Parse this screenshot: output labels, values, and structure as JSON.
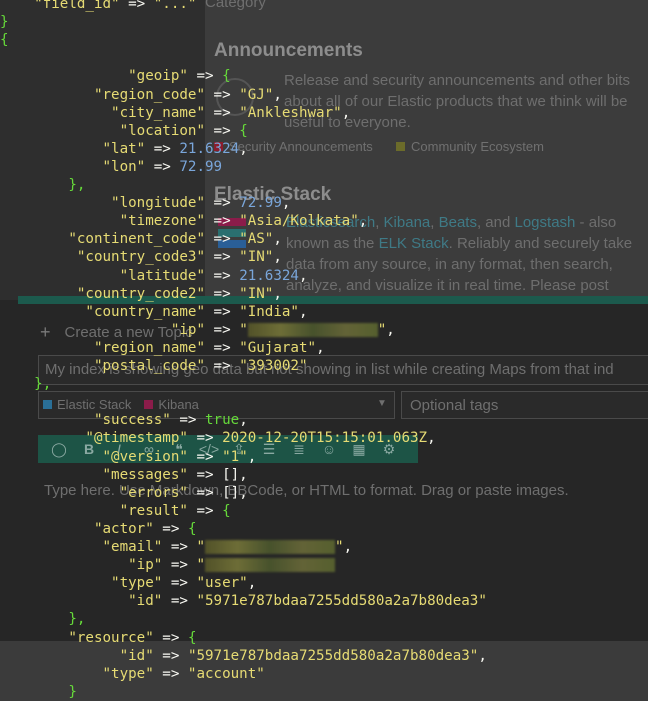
{
  "forum": {
    "category_label": "Category",
    "announcements": {
      "title": "Announcements",
      "description": "Release and security announcements and other bits about all of our Elastic products that we think will be useful to everyone.",
      "tags": [
        "Security Announcements",
        "Community Ecosystem"
      ]
    },
    "elastic_stack": {
      "title": "Elastic Stack",
      "desc_parts": [
        "Elasticsearch",
        ", ",
        "Kibana",
        ", ",
        "Beats",
        ", and ",
        "Logstash",
        " - also known as the ",
        "ELK Stack",
        ". Reliably and securely take data from any source, in any format, then search, analyze, and visualize it in real time. Please post"
      ]
    },
    "create_topic_label": "Create a new Topic",
    "topic_title_value": "My index is showing geo data but not showing in list while creating Maps from that ind",
    "category_select_value": "Elastic Stack",
    "category_tag": "Kibana",
    "optional_tags_placeholder": "Optional tags",
    "editor_placeholder": "Type here. Use Markdown, BBCode, or HTML to format. Drag or paste images."
  },
  "colors": {
    "security": "#8b1c2c",
    "community": "#6b6b2a",
    "elastic": "#2a6f97",
    "kibana": "#e64c7a",
    "toolbar": "#1d5446",
    "code_key": "#e6db74",
    "code_number": "#7aa6da",
    "code_brace": "#66d93a"
  },
  "code_lines": [
    {
      "indent": "    ",
      "parts": [
        [
          "k",
          "\"field_id\""
        ],
        [
          "o",
          " => "
        ],
        [
          "s",
          "\"...\""
        ]
      ]
    },
    {
      "indent": "",
      "parts": [
        [
          "p",
          "}"
        ]
      ]
    },
    {
      "indent": "",
      "parts": [
        [
          "p",
          "{"
        ]
      ]
    },
    {
      "indent": "",
      "parts": []
    },
    {
      "indent": "               ",
      "parts": [
        [
          "k",
          "\"geoip\""
        ],
        [
          "o",
          " => "
        ],
        [
          "p",
          "{"
        ]
      ]
    },
    {
      "indent": "           ",
      "parts": [
        [
          "k",
          "\"region_code\""
        ],
        [
          "o",
          " => "
        ],
        [
          "s",
          "\"GJ\""
        ],
        [
          "o",
          ","
        ]
      ]
    },
    {
      "indent": "             ",
      "parts": [
        [
          "k",
          "\"city_name\""
        ],
        [
          "o",
          " => "
        ],
        [
          "s",
          "\"Ankleshwar\""
        ],
        [
          "o",
          ","
        ]
      ]
    },
    {
      "indent": "              ",
      "parts": [
        [
          "k",
          "\"location\""
        ],
        [
          "o",
          " => "
        ],
        [
          "p",
          "{"
        ]
      ]
    },
    {
      "indent": "            ",
      "parts": [
        [
          "k",
          "\"lat\""
        ],
        [
          "o",
          " => "
        ],
        [
          "n",
          "21.6324"
        ],
        [
          "o",
          ","
        ]
      ]
    },
    {
      "indent": "            ",
      "parts": [
        [
          "k",
          "\"lon\""
        ],
        [
          "o",
          " => "
        ],
        [
          "n",
          "72.99"
        ]
      ]
    },
    {
      "indent": "        ",
      "parts": [
        [
          "p",
          "},"
        ]
      ]
    },
    {
      "indent": "             ",
      "parts": [
        [
          "k",
          "\"longitude\""
        ],
        [
          "o",
          " => "
        ],
        [
          "n",
          "72.99"
        ],
        [
          "o",
          ","
        ]
      ]
    },
    {
      "indent": "              ",
      "parts": [
        [
          "k",
          "\"timezone\""
        ],
        [
          "o",
          " => "
        ],
        [
          "s",
          "\"Asia/Kolkata\""
        ],
        [
          "o",
          ","
        ]
      ]
    },
    {
      "indent": "        ",
      "parts": [
        [
          "k",
          "\"continent_code\""
        ],
        [
          "o",
          " => "
        ],
        [
          "s",
          "\"AS\""
        ],
        [
          "o",
          ","
        ]
      ]
    },
    {
      "indent": "         ",
      "parts": [
        [
          "k",
          "\"country_code3\""
        ],
        [
          "o",
          " => "
        ],
        [
          "s",
          "\"IN\""
        ],
        [
          "o",
          ","
        ]
      ]
    },
    {
      "indent": "              ",
      "parts": [
        [
          "k",
          "\"latitude\""
        ],
        [
          "o",
          " => "
        ],
        [
          "n",
          "21.6324"
        ],
        [
          "o",
          ","
        ]
      ]
    },
    {
      "indent": "         ",
      "parts": [
        [
          "k",
          "\"country_code2\""
        ],
        [
          "o",
          " => "
        ],
        [
          "s",
          "\"IN\""
        ],
        [
          "o",
          ","
        ]
      ]
    },
    {
      "indent": "          ",
      "parts": [
        [
          "k",
          "\"country_name\""
        ],
        [
          "o",
          " => "
        ],
        [
          "s",
          "\"India\""
        ],
        [
          "o",
          ","
        ]
      ]
    },
    {
      "indent": "                    ",
      "parts": [
        [
          "k",
          "\"ip\""
        ],
        [
          "o",
          " => "
        ],
        [
          "s",
          "\""
        ],
        [
          "b",
          ""
        ],
        [
          "s",
          "\""
        ],
        [
          "o",
          ","
        ]
      ]
    },
    {
      "indent": "           ",
      "parts": [
        [
          "k",
          "\"region_name\""
        ],
        [
          "o",
          " => "
        ],
        [
          "s",
          "\"Gujarat\""
        ],
        [
          "o",
          ","
        ]
      ]
    },
    {
      "indent": "           ",
      "parts": [
        [
          "k",
          "\"postal_code\""
        ],
        [
          "o",
          " => "
        ],
        [
          "s",
          "\"393002\""
        ]
      ]
    },
    {
      "indent": "    ",
      "parts": [
        [
          "p",
          "},"
        ]
      ]
    },
    {
      "indent": "",
      "parts": []
    },
    {
      "indent": "           ",
      "parts": [
        [
          "k",
          "\"success\""
        ],
        [
          "o",
          " => "
        ],
        [
          "t",
          "true"
        ],
        [
          "o",
          ","
        ]
      ]
    },
    {
      "indent": "          ",
      "parts": [
        [
          "k",
          "\"@timestamp\""
        ],
        [
          "o",
          " => "
        ],
        [
          "s",
          "2020-12-20T15:15:01.063Z"
        ],
        [
          "o",
          ","
        ]
      ]
    },
    {
      "indent": "            ",
      "parts": [
        [
          "k",
          "\"@version\""
        ],
        [
          "o",
          " => "
        ],
        [
          "s",
          "\"1\""
        ],
        [
          "o",
          ","
        ]
      ]
    },
    {
      "indent": "            ",
      "parts": [
        [
          "k",
          "\"messages\""
        ],
        [
          "o",
          " => "
        ],
        [
          "o",
          "[],"
        ]
      ]
    },
    {
      "indent": "              ",
      "parts": [
        [
          "k",
          "\"errors\""
        ],
        [
          "o",
          " => "
        ],
        [
          "o",
          "[],"
        ]
      ]
    },
    {
      "indent": "              ",
      "parts": [
        [
          "k",
          "\"result\""
        ],
        [
          "o",
          " => "
        ],
        [
          "p",
          "{"
        ]
      ]
    },
    {
      "indent": "           ",
      "parts": [
        [
          "k",
          "\"actor\""
        ],
        [
          "o",
          " => "
        ],
        [
          "p",
          "{"
        ]
      ]
    },
    {
      "indent": "            ",
      "parts": [
        [
          "k",
          "\"email\""
        ],
        [
          "o",
          " => "
        ],
        [
          "s",
          "\""
        ],
        [
          "b",
          ""
        ],
        [
          "s",
          "\""
        ],
        [
          "o",
          ","
        ]
      ]
    },
    {
      "indent": "               ",
      "parts": [
        [
          "k",
          "\"ip\""
        ],
        [
          "o",
          " => "
        ],
        [
          "s",
          "\""
        ],
        [
          "b",
          ""
        ]
      ]
    },
    {
      "indent": "             ",
      "parts": [
        [
          "k",
          "\"type\""
        ],
        [
          "o",
          " => "
        ],
        [
          "s",
          "\"user\""
        ],
        [
          "o",
          ","
        ]
      ]
    },
    {
      "indent": "               ",
      "parts": [
        [
          "k",
          "\"id\""
        ],
        [
          "o",
          " => "
        ],
        [
          "s",
          "\"5971e787bdaa7255dd580a2a7b80dea3\""
        ]
      ]
    },
    {
      "indent": "        ",
      "parts": [
        [
          "p",
          "},"
        ]
      ]
    },
    {
      "indent": "        ",
      "parts": [
        [
          "k",
          "\"resource\""
        ],
        [
          "o",
          " => "
        ],
        [
          "p",
          "{"
        ]
      ]
    },
    {
      "indent": "              ",
      "parts": [
        [
          "k",
          "\"id\""
        ],
        [
          "o",
          " => "
        ],
        [
          "s",
          "\"5971e787bdaa7255dd580a2a7b80dea3\""
        ],
        [
          "o",
          ","
        ]
      ]
    },
    {
      "indent": "            ",
      "parts": [
        [
          "k",
          "\"type\""
        ],
        [
          "o",
          " => "
        ],
        [
          "s",
          "\"account\""
        ]
      ]
    },
    {
      "indent": "        ",
      "parts": [
        [
          "p",
          "}"
        ]
      ]
    }
  ]
}
